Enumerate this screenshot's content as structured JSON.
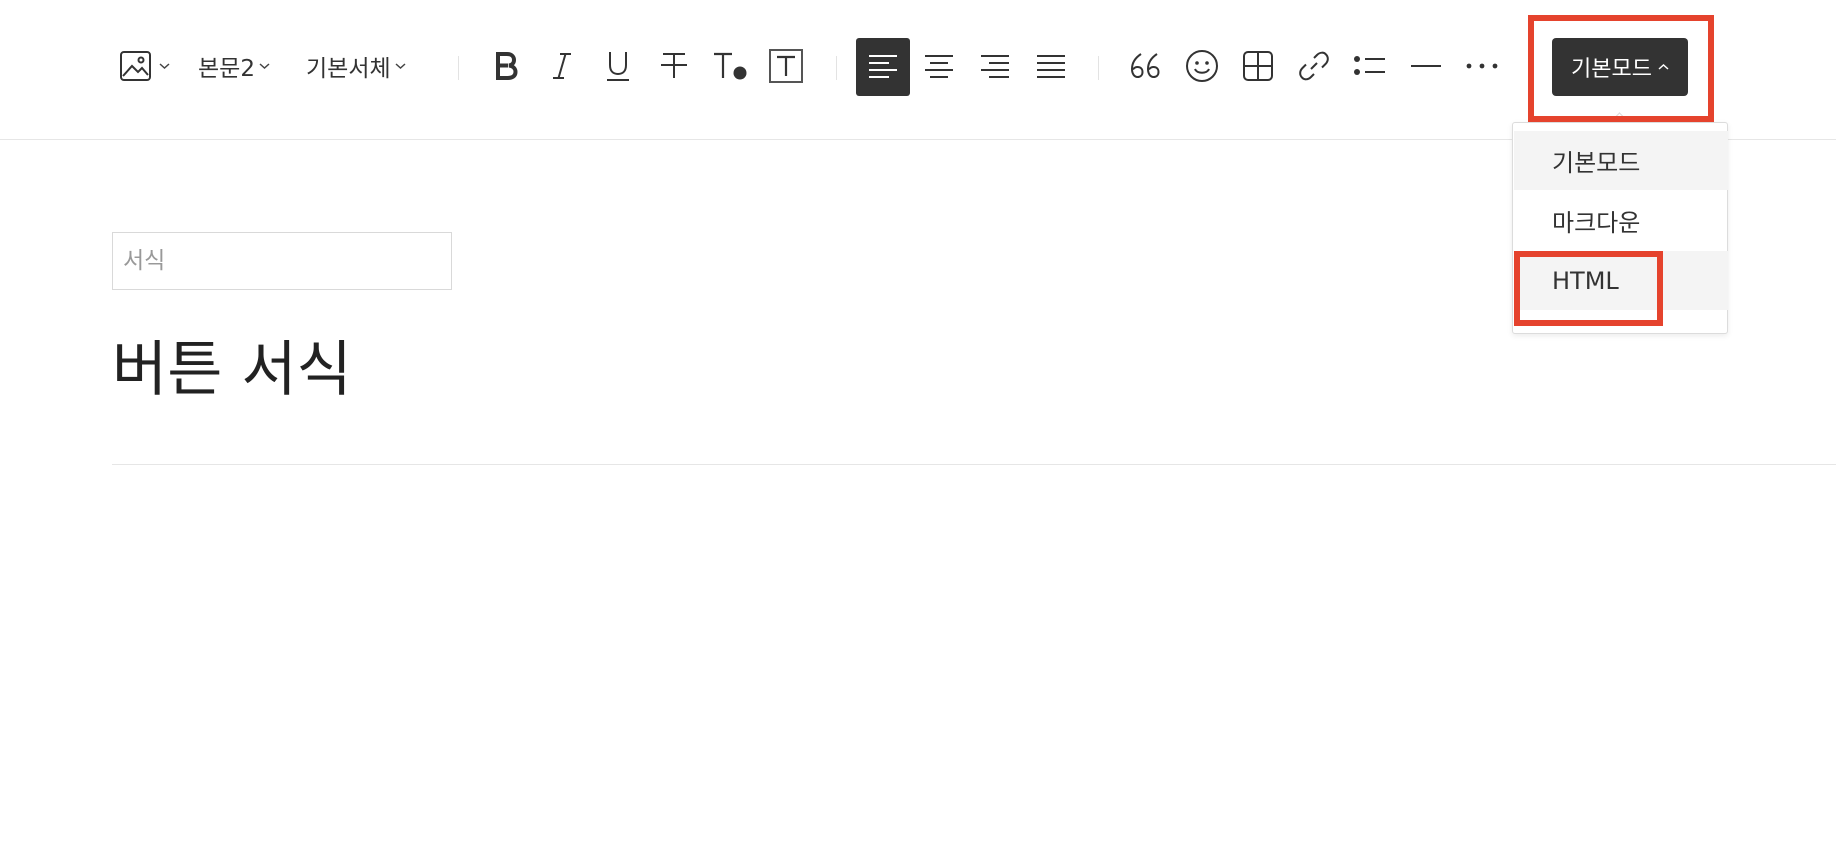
{
  "toolbar": {
    "paragraph_style": "본문2",
    "font_family": "기본서체",
    "mode_button_label": "기본모드"
  },
  "mode_menu": {
    "items": [
      {
        "label": "기본모드"
      },
      {
        "label": "마크다운"
      },
      {
        "label": "HTML"
      }
    ]
  },
  "editor": {
    "category_placeholder": "서식",
    "title": "버튼 서식"
  },
  "colors": {
    "highlight": "#e5432d",
    "active_button": "#333333"
  }
}
